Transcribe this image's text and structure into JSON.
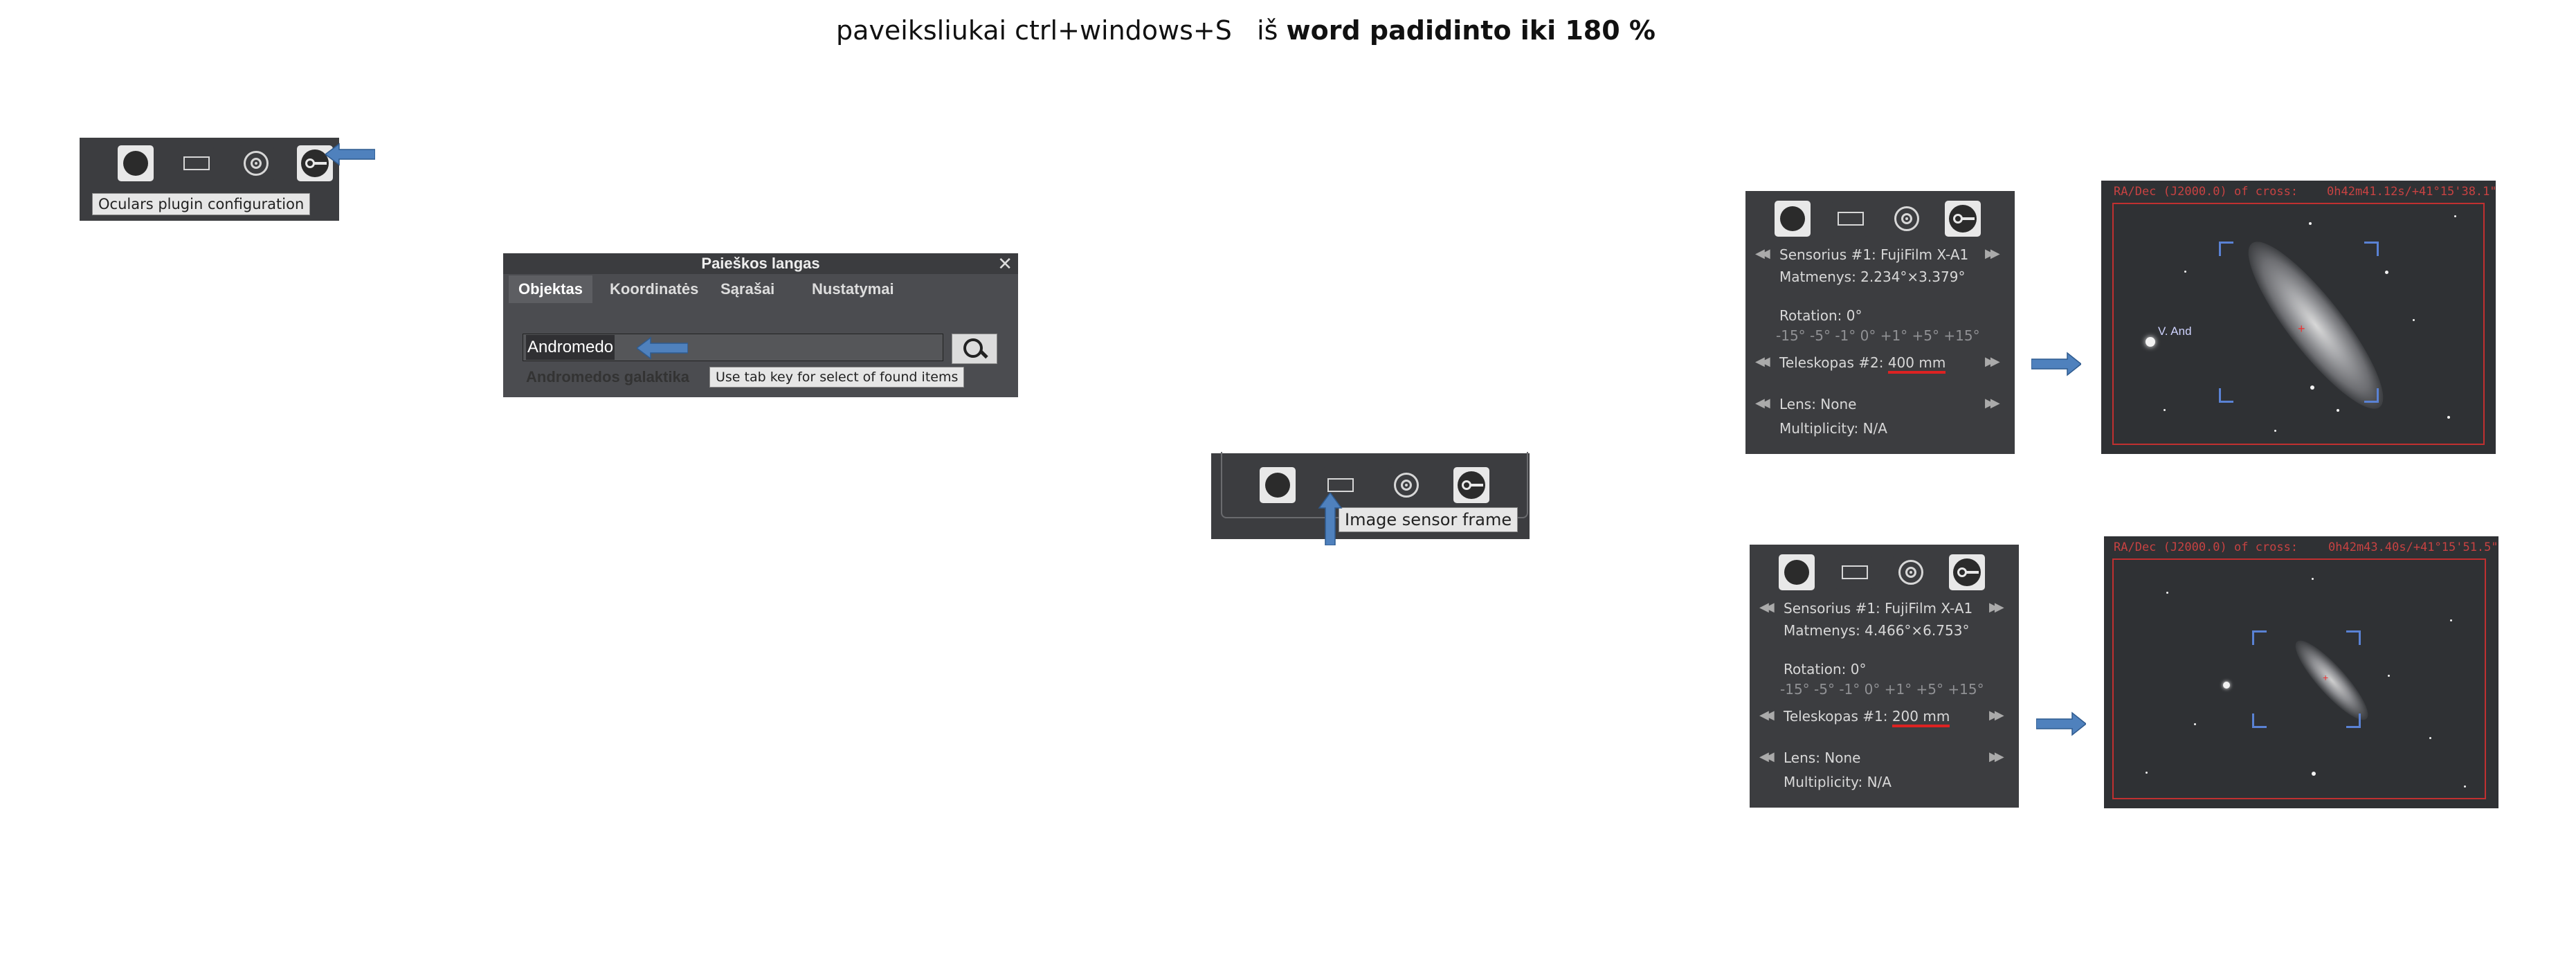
{
  "title": {
    "prefix": "paveiksliukai ctrl+windows+S   iš ",
    "bold": "word padidinto iki 180 %"
  },
  "colors": {
    "panel": "#3c3d40",
    "arrow": "#4f81bd",
    "red_marker": "#d22222",
    "sky": "#2f3134",
    "reticle": "#5a82d4"
  },
  "icons": [
    "ocular-circle-icon",
    "sensor-frame-icon",
    "telrad-rings-icon",
    "wrench-config-icon",
    "search-icon",
    "close-icon",
    "blue-arrow-icon",
    "prev-arrow-icon",
    "next-arrow-icon"
  ],
  "toolbar1": {
    "tooltip": "Oculars plugin configuration"
  },
  "search": {
    "title": "Paieškos langas",
    "close": "✕",
    "tabs": [
      "Objektas",
      "Koordinatės",
      "Sąrašai",
      "Nustatymai"
    ],
    "input_value": "Andromedo",
    "result": "Andromedos galaktika",
    "tooltip": "Use tab key for select of found items"
  },
  "toolbar2": {
    "tooltip": "Image sensor frame"
  },
  "panel1": {
    "sensor": "Sensorius #1: FujiFilm X-A1",
    "size": "Matmenys: 2.234°×3.379°",
    "rotation": "Rotation: 0°",
    "rotation_steps": "-15° -5° -1° 0° +1° +5° +15°",
    "telescope_prefix": "Teleskopas #2: ",
    "telescope_focal": "400 mm",
    "lens": "Lens: None",
    "multiplicity": "Multiplicity: N/A"
  },
  "panel2": {
    "sensor": "Sensorius #1: FujiFilm X-A1",
    "size": "Matmenys: 4.466°×6.753°",
    "rotation": "Rotation: 0°",
    "rotation_steps": "-15° -5° -1° 0° +1° +5° +15°",
    "telescope_prefix": "Teleskopas #1: ",
    "telescope_focal": "200 mm",
    "lens": "Lens: None",
    "multiplicity": "Multiplicity: N/A"
  },
  "sky1": {
    "header_label": "RA/Dec (J2000.0) of cross:",
    "header_coords": "0h42m41.12s/+41°15'38.1\"",
    "star_label": "V. And"
  },
  "sky2": {
    "header_label": "RA/Dec (J2000.0) of cross:",
    "header_coords": "0h42m43.40s/+41°15'51.5\""
  }
}
